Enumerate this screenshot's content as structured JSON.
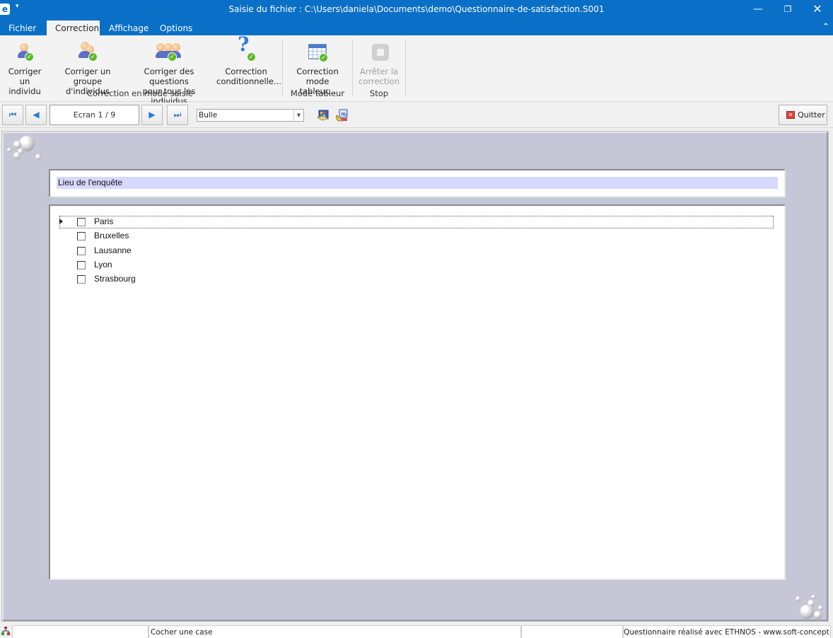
{
  "window": {
    "title": "Saisie du fichier : C:\\Users\\daniela\\Documents\\demo\\Questionnaire-de-satisfaction.S001",
    "app_icon": "ethnos-logo-icon",
    "controls": {
      "minimize": "—",
      "maximize": "❐",
      "close": "✕"
    }
  },
  "menu": {
    "tabs": [
      {
        "label": "Fichier",
        "active": false
      },
      {
        "label": "Correction",
        "active": true
      },
      {
        "label": "Affichage",
        "active": false
      },
      {
        "label": "Options",
        "active": false
      }
    ],
    "collapse_icon": "^"
  },
  "ribbon": {
    "groups": [
      {
        "label": "Correction en mode saisie",
        "buttons": [
          {
            "line1": "Corriger un",
            "line2": "individu",
            "icon": "user-check-icon",
            "enabled": true
          },
          {
            "line1": "Corriger un",
            "line2": "groupe d'individus",
            "icon": "group-check-icon",
            "enabled": true
          },
          {
            "line1": "Corriger des questions",
            "line2": "pour tous les individus",
            "icon": "all-users-check-icon",
            "enabled": true
          },
          {
            "line1": "Correction",
            "line2": "conditionnelle...",
            "icon": "question-check-icon",
            "enabled": true
          }
        ]
      },
      {
        "label": "Mode tableur",
        "buttons": [
          {
            "line1": "Correction",
            "line2": "mode tableur...",
            "icon": "spreadsheet-check-icon",
            "enabled": true
          }
        ]
      },
      {
        "label": "Stop",
        "buttons": [
          {
            "line1": "Arrêter la",
            "line2": "correction",
            "icon": "stop-icon",
            "enabled": false
          }
        ]
      }
    ]
  },
  "navigation": {
    "first": "⏮",
    "prev": "◀",
    "screen": "Ecran 1 / 9",
    "next": "▶",
    "last": "⏭",
    "display_mode": "Bulle",
    "dropdown_arrow": "▼",
    "quit_label": "Quitter",
    "quit_icon": "✕"
  },
  "question": {
    "title": "Lieu de l'enquête",
    "options": [
      {
        "label": "Paris",
        "checked": false,
        "focused": true
      },
      {
        "label": "Bruxelles",
        "checked": false,
        "focused": false
      },
      {
        "label": "Lausanne",
        "checked": false,
        "focused": false
      },
      {
        "label": "Lyon",
        "checked": false,
        "focused": false
      },
      {
        "label": "Strasbourg",
        "checked": false,
        "focused": false
      }
    ]
  },
  "statusbar": {
    "cell1": "",
    "cell2": "Cocher une case",
    "cell3": "",
    "cell4": "Questionnaire réalisé avec ETHNOS - www.soft-concept.com"
  }
}
